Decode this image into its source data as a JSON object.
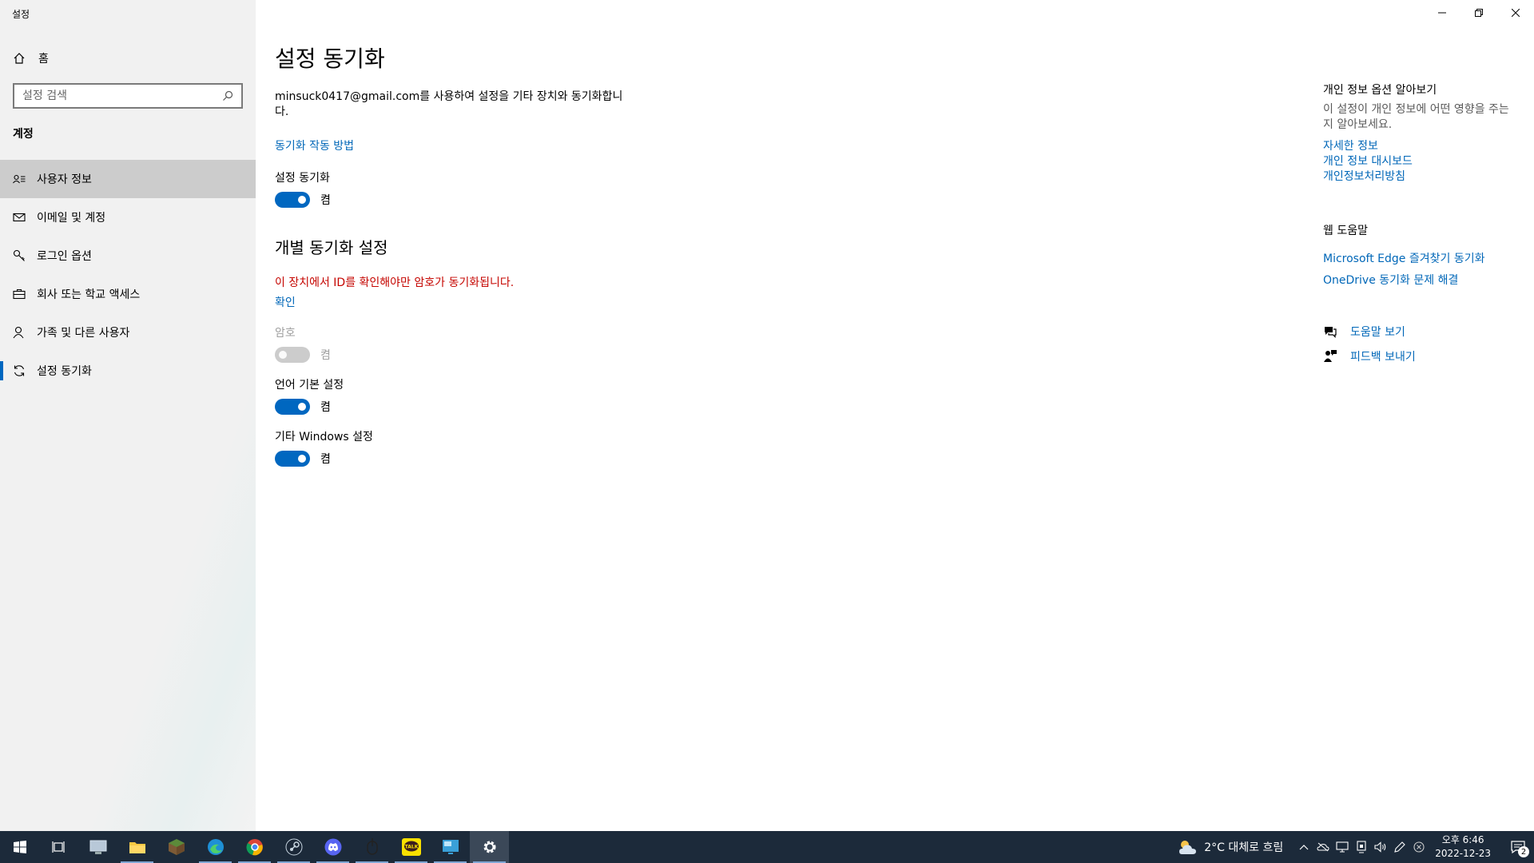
{
  "window": {
    "app_title": "설정"
  },
  "sidebar": {
    "home_label": "홈",
    "search_placeholder": "설정 검색",
    "section_title": "계정",
    "items": [
      {
        "label": "사용자 정보",
        "icon": "person-card-icon"
      },
      {
        "label": "이메일 및 계정",
        "icon": "mail-icon"
      },
      {
        "label": "로그인 옵션",
        "icon": "key-icon"
      },
      {
        "label": "회사 또는 학교 액세스",
        "icon": "briefcase-icon"
      },
      {
        "label": "가족 및 다른 사용자",
        "icon": "person-icon"
      },
      {
        "label": "설정 동기화",
        "icon": "sync-icon"
      }
    ]
  },
  "main": {
    "title": "설정 동기화",
    "description": "minsuck0417@gmail.com를 사용하여 설정을 기타 장치와 동기화합니다.",
    "how_sync_works_link": "동기화 작동 방법",
    "sync_settings": {
      "label": "설정 동기화",
      "state": "켬",
      "on": true
    },
    "individual_title": "개별 동기화 설정",
    "warning": "이 장치에서 ID를 확인해야만 암호가 동기화됩니다.",
    "verify_link": "확인",
    "password": {
      "label": "암호",
      "state": "켬",
      "disabled": true
    },
    "language": {
      "label": "언어 기본 설정",
      "state": "켬",
      "on": true
    },
    "other_windows": {
      "label": "기타 Windows 설정",
      "state": "켬",
      "on": true
    }
  },
  "right_panel": {
    "privacy_heading": "개인 정보 옵션 알아보기",
    "privacy_text": "이 설정이 개인 정보에 어떤 영향을 주는지 알아보세요.",
    "privacy_links": [
      "자세한 정보",
      "개인 정보 대시보드",
      "개인정보처리방침"
    ],
    "web_help_heading": "웹 도움말",
    "web_help_links": [
      "Microsoft Edge 즐겨찾기 동기화",
      "OneDrive 동기화 문제 해결"
    ],
    "get_help": "도움말 보기",
    "give_feedback": "피드백 보내기"
  },
  "taskbar": {
    "apps": [
      "file-explorer-icon",
      "minecraft-icon",
      "edge-icon",
      "chrome-icon",
      "steam-icon",
      "discord-icon",
      "mouse-app-icon",
      "kakaotalk-icon",
      "remote-desktop-icon",
      "settings-icon"
    ],
    "weather": "2°C 대체로 흐림",
    "time": "오후 6:46",
    "date": "2022-12-23",
    "notification_count": "2"
  },
  "colors": {
    "accent": "#0067c0",
    "link": "#0067b8",
    "warning": "#c50500",
    "sidebar_bg": "#f1f1f1",
    "selected_bg": "#cccccc",
    "taskbar_bg": "#1c2a3a"
  }
}
